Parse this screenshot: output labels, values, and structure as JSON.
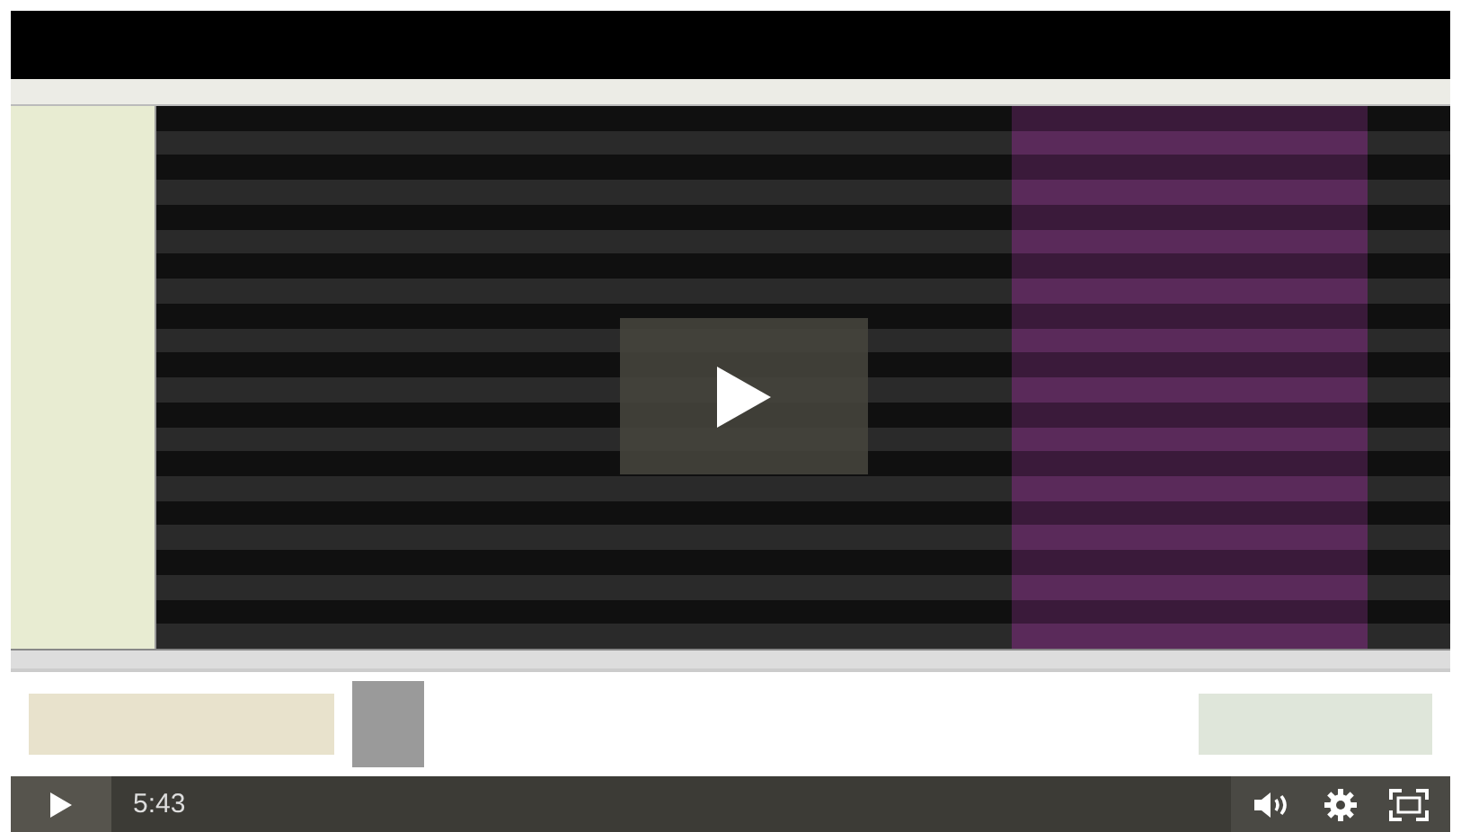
{
  "player": {
    "time": "5:43",
    "playing": false
  }
}
